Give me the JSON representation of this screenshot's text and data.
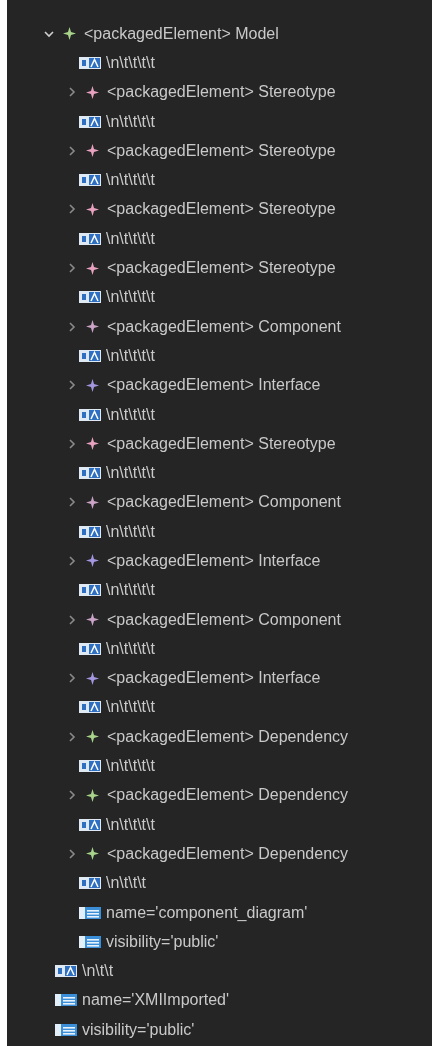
{
  "tree": [
    {
      "kind": "element",
      "label": "<packagedElement> Model",
      "color": "#a8d48a",
      "expanded": true,
      "children": [
        {
          "kind": "text",
          "label": "\\n\\t\\t\\t\\t"
        },
        {
          "kind": "element",
          "label": "<packagedElement> Stereotype",
          "color": "#e8a2bf",
          "expanded": false
        },
        {
          "kind": "text",
          "label": "\\n\\t\\t\\t\\t"
        },
        {
          "kind": "element",
          "label": "<packagedElement> Stereotype",
          "color": "#e8a2bf",
          "expanded": false
        },
        {
          "kind": "text",
          "label": "\\n\\t\\t\\t\\t"
        },
        {
          "kind": "element",
          "label": "<packagedElement> Stereotype",
          "color": "#e8a2bf",
          "expanded": false
        },
        {
          "kind": "text",
          "label": "\\n\\t\\t\\t\\t"
        },
        {
          "kind": "element",
          "label": "<packagedElement> Stereotype",
          "color": "#e8a2bf",
          "expanded": false
        },
        {
          "kind": "text",
          "label": "\\n\\t\\t\\t\\t"
        },
        {
          "kind": "element",
          "label": "<packagedElement> Component",
          "color": "#cba3c6",
          "expanded": false
        },
        {
          "kind": "text",
          "label": "\\n\\t\\t\\t\\t"
        },
        {
          "kind": "element",
          "label": "<packagedElement> Interface",
          "color": "#a596e0",
          "expanded": false
        },
        {
          "kind": "text",
          "label": "\\n\\t\\t\\t\\t"
        },
        {
          "kind": "element",
          "label": "<packagedElement> Stereotype",
          "color": "#e8a2bf",
          "expanded": false
        },
        {
          "kind": "text",
          "label": "\\n\\t\\t\\t\\t"
        },
        {
          "kind": "element",
          "label": "<packagedElement> Component",
          "color": "#cba3c6",
          "expanded": false
        },
        {
          "kind": "text",
          "label": "\\n\\t\\t\\t\\t"
        },
        {
          "kind": "element",
          "label": "<packagedElement> Interface",
          "color": "#a596e0",
          "expanded": false
        },
        {
          "kind": "text",
          "label": "\\n\\t\\t\\t\\t"
        },
        {
          "kind": "element",
          "label": "<packagedElement> Component",
          "color": "#cba3c6",
          "expanded": false
        },
        {
          "kind": "text",
          "label": "\\n\\t\\t\\t\\t"
        },
        {
          "kind": "element",
          "label": "<packagedElement> Interface",
          "color": "#a596e0",
          "expanded": false
        },
        {
          "kind": "text",
          "label": "\\n\\t\\t\\t\\t"
        },
        {
          "kind": "element",
          "label": "<packagedElement> Dependency",
          "color": "#a8d48a",
          "expanded": false
        },
        {
          "kind": "text",
          "label": "\\n\\t\\t\\t\\t"
        },
        {
          "kind": "element",
          "label": "<packagedElement> Dependency",
          "color": "#a8d48a",
          "expanded": false
        },
        {
          "kind": "text",
          "label": "\\n\\t\\t\\t\\t"
        },
        {
          "kind": "element",
          "label": "<packagedElement> Dependency",
          "color": "#a8d48a",
          "expanded": false
        },
        {
          "kind": "text",
          "label": "\\n\\t\\t\\t"
        },
        {
          "kind": "attribute",
          "label": "name='component_diagram'"
        },
        {
          "kind": "attribute",
          "label": "visibility='public'"
        }
      ]
    },
    {
      "kind": "text",
      "label": "\\n\\t\\t"
    },
    {
      "kind": "attribute",
      "label": "name='XMIImported'"
    },
    {
      "kind": "attribute",
      "label": "visibility='public'"
    }
  ]
}
